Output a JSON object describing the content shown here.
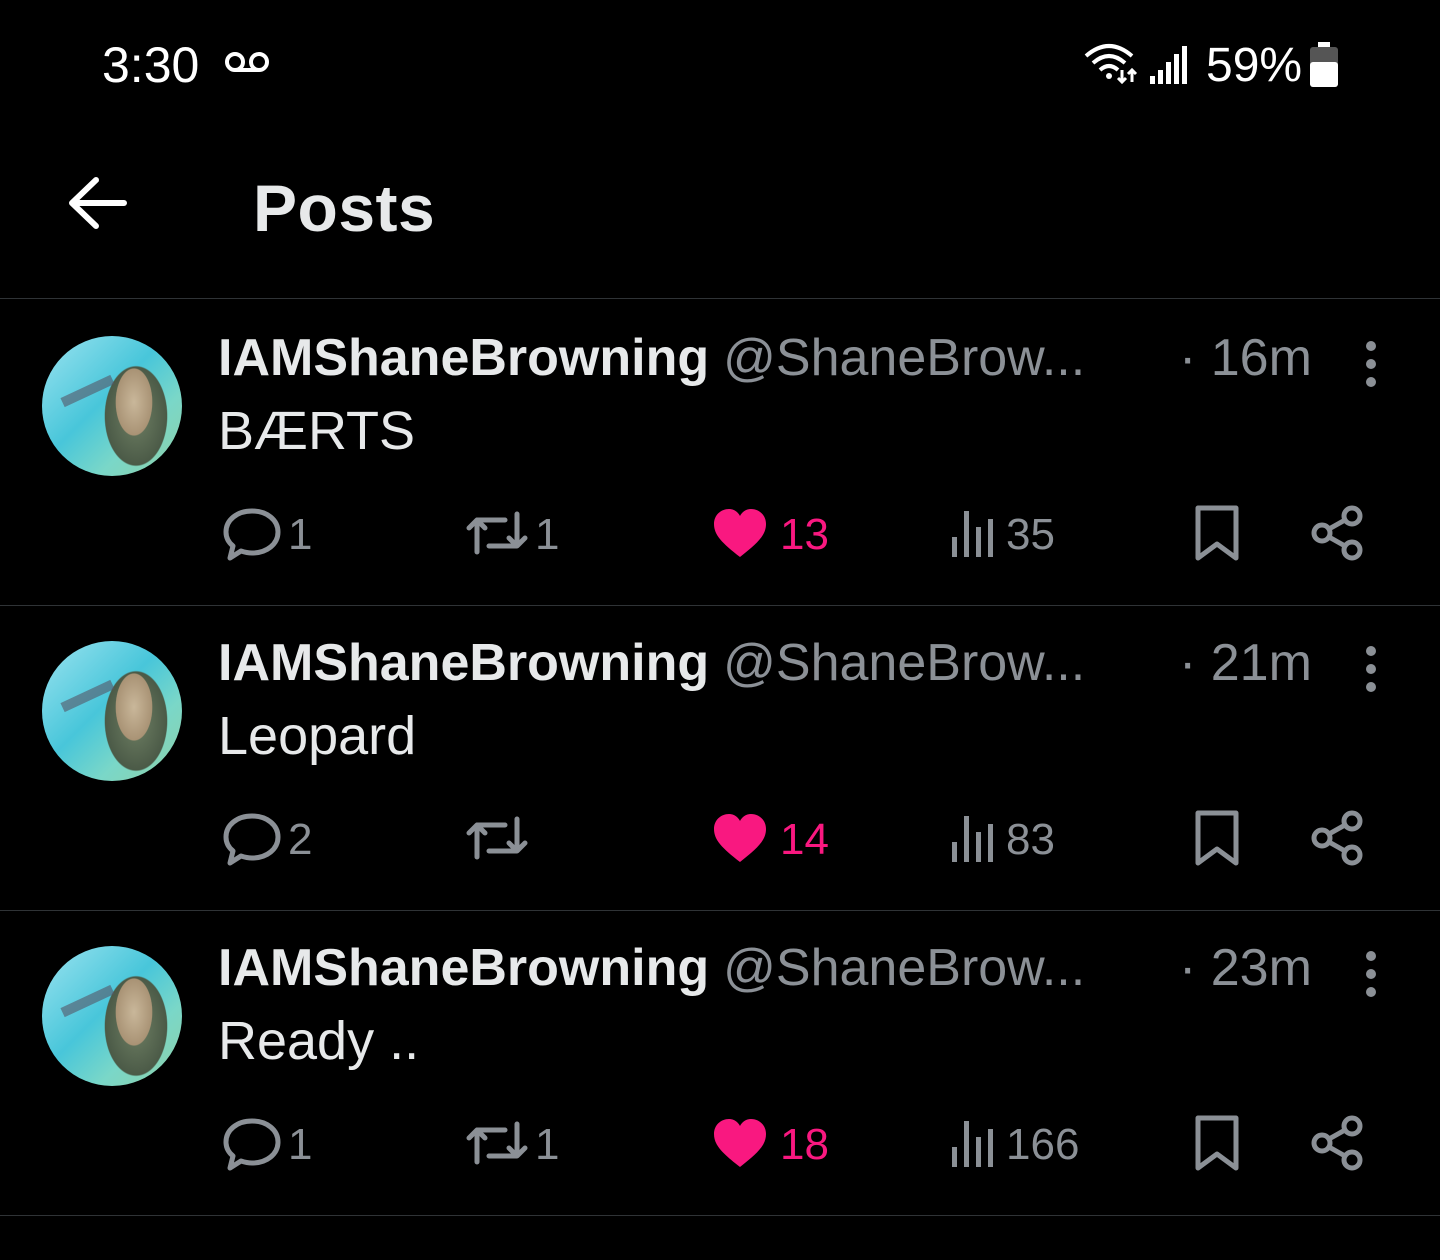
{
  "status_bar": {
    "time": "3:30",
    "battery_percent": "59%",
    "icons": [
      "voicemail-icon",
      "wifi-icon",
      "signal-icon",
      "battery-icon"
    ]
  },
  "header": {
    "title": "Posts",
    "back_icon": "back-arrow-icon"
  },
  "colors": {
    "background": "#000000",
    "text_primary": "#e7e9ea",
    "text_secondary": "#8b9096",
    "like_active": "#f91880",
    "divider": "#2f3336"
  },
  "posts": [
    {
      "display_name": "IAMShaneBrowning",
      "handle": "@ShaneBrow...",
      "time": "· 16m",
      "text": "BÆRTS",
      "replies": "1",
      "reposts": "1",
      "likes": "13",
      "views": "35",
      "liked": true
    },
    {
      "display_name": "IAMShaneBrowning",
      "handle": "@ShaneBrow...",
      "time": "· 21m",
      "text": "Leopard",
      "replies": "2",
      "reposts": "",
      "likes": "14",
      "views": "83",
      "liked": true
    },
    {
      "display_name": "IAMShaneBrowning",
      "handle": "@ShaneBrow...",
      "time": "· 23m",
      "text": "Ready ..",
      "replies": "1",
      "reposts": "1",
      "likes": "18",
      "views": "166",
      "liked": true
    }
  ]
}
